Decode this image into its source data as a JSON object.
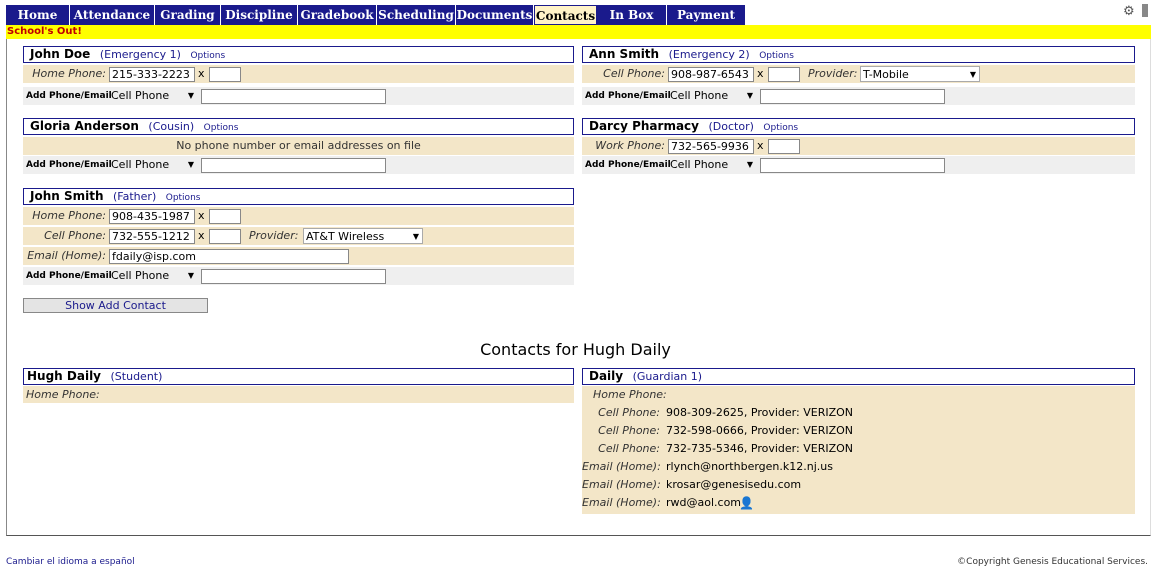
{
  "nav": {
    "tabs": [
      {
        "label": "Home",
        "w": 64
      },
      {
        "label": "Attendance",
        "w": 85
      },
      {
        "label": "Grading",
        "w": 66
      },
      {
        "label": "Discipline",
        "w": 77
      },
      {
        "label": "Gradebook",
        "w": 79
      },
      {
        "label": "Scheduling",
        "w": 79
      },
      {
        "label": "Documents",
        "w": 78
      },
      {
        "label": "Contacts",
        "w": 63
      },
      {
        "label": "In Box",
        "w": 70
      },
      {
        "label": "Payment",
        "w": 79
      }
    ],
    "active": "Contacts"
  },
  "banner": "School's Out!",
  "contacts": {
    "john_doe": {
      "name": "John Doe",
      "relation": "(Emergency 1)",
      "options": "Options",
      "home_phone_label": "Home Phone:",
      "home_phone": "215-333-2223",
      "ext": "x",
      "add_label": "Add Phone/Email",
      "add_type": "Cell Phone"
    },
    "ann_smith": {
      "name": "Ann Smith",
      "relation": "(Emergency 2)",
      "options": "Options",
      "cell_phone_label": "Cell Phone:",
      "cell_phone": "908-987-6543",
      "ext": "x",
      "provider_label": "Provider:",
      "provider": "T-Mobile",
      "add_label": "Add Phone/Email",
      "add_type": "Cell Phone"
    },
    "gloria": {
      "name": "Gloria Anderson",
      "relation": "(Cousin)",
      "options": "Options",
      "no_info": "No phone number or email addresses on file",
      "add_label": "Add Phone/Email",
      "add_type": "Cell Phone"
    },
    "darcy": {
      "name": "Darcy Pharmacy",
      "relation": "(Doctor)",
      "options": "Options",
      "work_phone_label": "Work Phone:",
      "work_phone": "732-565-9936",
      "ext": "x",
      "add_label": "Add Phone/Email",
      "add_type": "Cell Phone"
    },
    "john_smith": {
      "name": "John Smith",
      "relation": "(Father)",
      "options": "Options",
      "home_phone_label": "Home Phone:",
      "home_phone": "908-435-1987",
      "cell_phone_label": "Cell Phone:",
      "cell_phone": "732-555-1212",
      "ext": "x",
      "provider_label": "Provider:",
      "provider": "AT&T Wireless",
      "email_label": "Email (Home):",
      "email": "fdaily@isp.com",
      "add_label": "Add Phone/Email",
      "add_type": "Cell Phone"
    }
  },
  "show_add_contact": "Show Add Contact",
  "section_title": "Contacts for Hugh Daily",
  "student": {
    "name": "Hugh Daily",
    "relation": "(Student)",
    "home_phone_label": "Home Phone:"
  },
  "guardian": {
    "name": "Daily",
    "relation": "(Guardian 1)",
    "home_phone_label": "Home Phone:",
    "cell_label": "Cell Phone:",
    "cells": [
      "908-309-2625, Provider: VERIZON",
      "732-598-0666, Provider: VERIZON",
      "732-735-5346, Provider: VERIZON"
    ],
    "email_label": "Email (Home):",
    "emails": [
      "rlynch@northbergen.k12.nj.us",
      "krosar@genesisedu.com",
      "rwd@aol.com"
    ]
  },
  "footer": {
    "language_link": "Cambiar el idioma a español",
    "copyright": "©Copyright Genesis Educational Services."
  }
}
